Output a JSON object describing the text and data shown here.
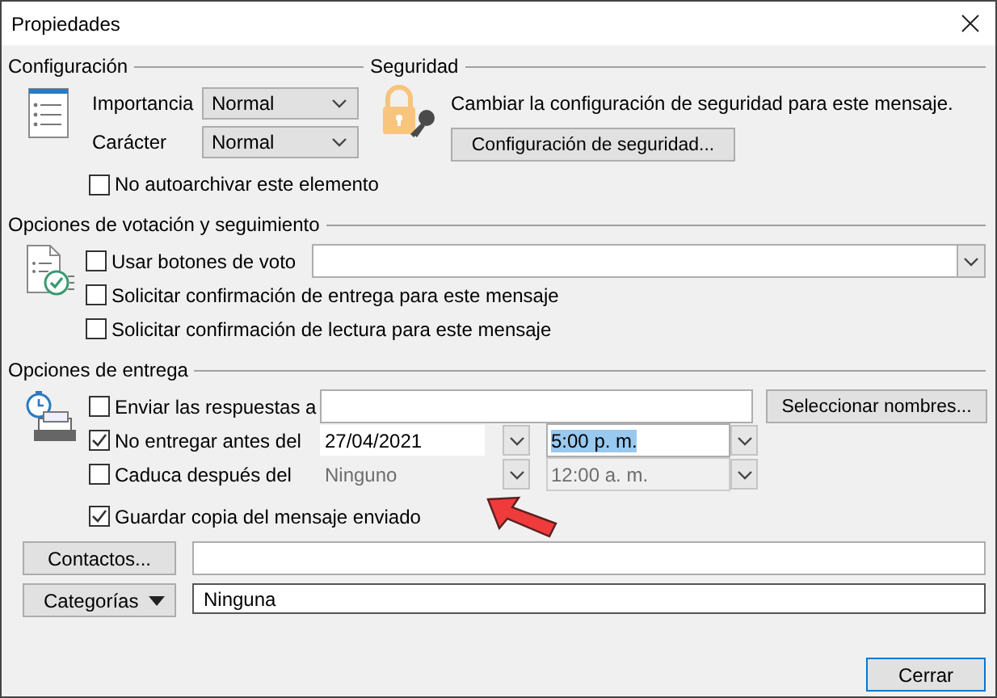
{
  "window": {
    "title": "Propiedades"
  },
  "configuracion": {
    "title": "Configuración",
    "fields": [
      {
        "label": "Importancia",
        "value": "Normal"
      },
      {
        "label": "Carácter",
        "value": "Normal"
      }
    ],
    "checkbox": {
      "label": "No autoarchivar este elemento",
      "checked": false
    }
  },
  "seguridad": {
    "title": "Seguridad",
    "text": "Cambiar la configuración de seguridad para este mensaje.",
    "button": "Configuración de seguridad..."
  },
  "votacion": {
    "title": "Opciones de votación y seguimiento",
    "options": [
      {
        "kind": "combo",
        "label": "Usar botones de voto",
        "checked": false
      },
      {
        "kind": "plain",
        "label": "Solicitar confirmación de entrega para este mensaje",
        "checked": false
      },
      {
        "kind": "plain",
        "label": "Solicitar confirmación de lectura para este mensaje",
        "checked": false
      }
    ]
  },
  "entrega": {
    "title": "Opciones de entrega",
    "options": [
      {
        "kind": "recipient",
        "label": "Enviar las respuestas a",
        "checked": false,
        "button": "Seleccionar nombres..."
      },
      {
        "kind": "datetime",
        "label": "No entregar antes del",
        "checked": true,
        "date": "27/04/2021",
        "time": "5:00 p. m.",
        "time_selected": true,
        "disabled": false
      },
      {
        "kind": "datetime",
        "label": "Caduca después del",
        "checked": false,
        "date": "Ninguno",
        "time": "12:00 a. m.",
        "time_selected": false,
        "disabled": true
      },
      {
        "kind": "plain",
        "label": "Guardar copia del mensaje enviado",
        "checked": true
      }
    ]
  },
  "contactos": {
    "button": "Contactos..."
  },
  "categorias": {
    "button": "Categorías",
    "value": "Ninguna"
  },
  "footer": {
    "button": "Cerrar"
  }
}
